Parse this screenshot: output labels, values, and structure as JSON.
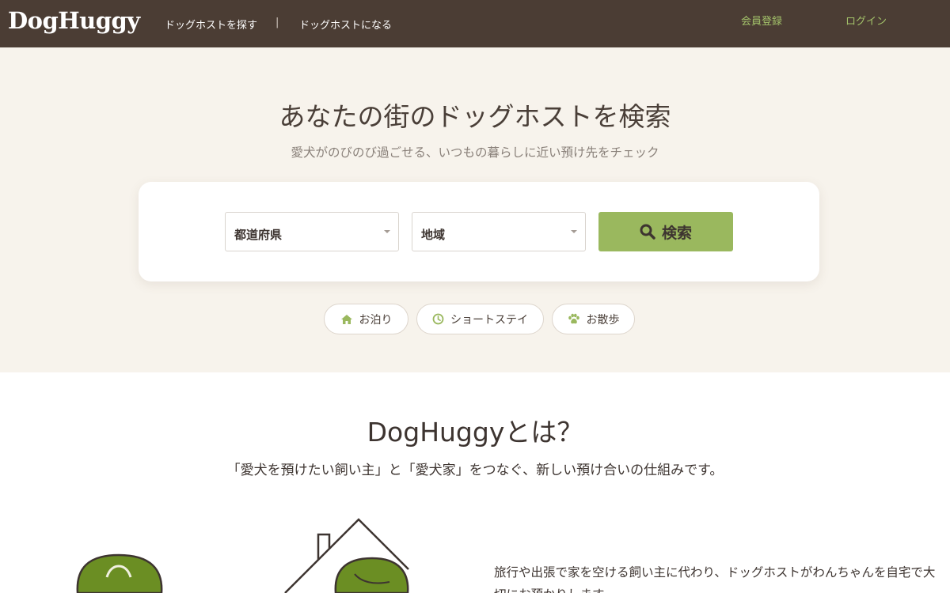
{
  "header": {
    "logo": "DogHuggy",
    "nav": [
      "ドッグホストを探す",
      "ドッグホストになる"
    ],
    "separator": "|",
    "register": "会員登録",
    "login": "ログイン"
  },
  "hero": {
    "title": "あなたの街のドッグホストを検索",
    "subtitle": "愛犬がのびのび過ごせる、いつもの暮らしに近い預け先をチェック"
  },
  "search": {
    "prefecture_value": "都道府県",
    "area_value": "地域",
    "button_label": "検索"
  },
  "chips": [
    {
      "label": "お泊り",
      "icon": "home-icon"
    },
    {
      "label": "ショートステイ",
      "icon": "clock-icon"
    },
    {
      "label": "お散歩",
      "icon": "paw-icon"
    }
  ],
  "about": {
    "title": "DogHuggyとは？",
    "subtitle": "「愛犬を預けたい飼い主」と「愛犬家」をつなぐ、新しい預け合いの仕組みです。",
    "body": "旅行や出張で家を空ける飼い主に代わり、ドッグホストがわんちゃんを自宅で大切にお預かりします。"
  },
  "colors": {
    "header_bg": "#4b3d34",
    "hero_bg": "#f7f3ec",
    "accent_green": "#9ab85e",
    "link_green": "#a3c26a",
    "illustration_green": "#6b8e23"
  }
}
